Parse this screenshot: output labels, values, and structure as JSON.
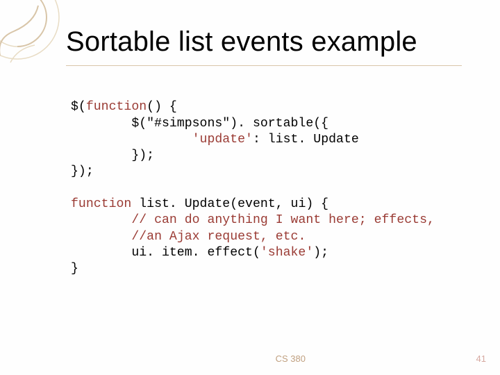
{
  "slide": {
    "title": "Sortable list events example",
    "course": "CS 380",
    "page_number": "41"
  },
  "code": {
    "l1_a": "$(",
    "l1_b": "function",
    "l1_c": "() {",
    "l2": "        $(\"#simpsons\"). sortable({",
    "l3_a": "                ",
    "l3_b": "'update'",
    "l3_c": ": list. Update",
    "l4": "        });",
    "l5": "});",
    "blank1": "",
    "l6_a": "function",
    "l6_b": " list. Update(event, ui) {",
    "l7_a": "        ",
    "l7_b": "// can do anything I want here; effects,",
    "l8_a": "        ",
    "l8_b": "//an Ajax request, etc.",
    "l9_a": "        ui. item. effect(",
    "l9_b": "'shake'",
    "l9_c": ");",
    "l10": "}"
  }
}
